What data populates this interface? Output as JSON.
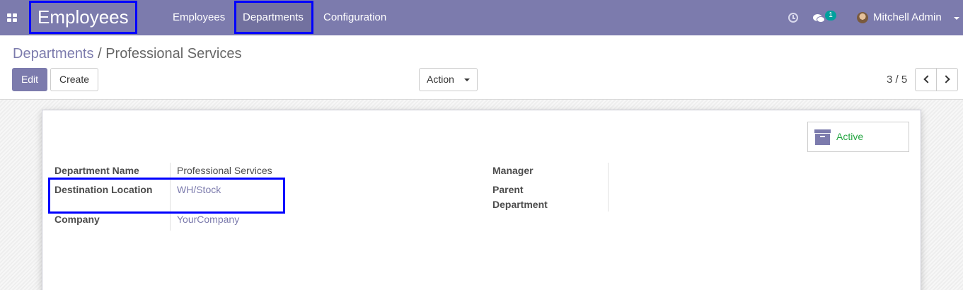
{
  "navbar": {
    "app_title": "Employees",
    "menu": [
      "Employees",
      "Departments",
      "Configuration"
    ],
    "chat_count": "1",
    "user_name": "Mitchell Admin"
  },
  "breadcrumb": {
    "parent": "Departments",
    "separator": "/",
    "current": "Professional Services"
  },
  "buttons": {
    "edit": "Edit",
    "create": "Create",
    "action": "Action"
  },
  "pager": {
    "value": "3 / 5"
  },
  "sheet": {
    "status_button": "Active",
    "fields_left": [
      {
        "label": "Department Name",
        "value": "Professional Services"
      },
      {
        "label": "Destination Location",
        "value": "WH/Stock"
      },
      {
        "label": "Company",
        "value": "YourCompany"
      }
    ],
    "fields_right": [
      {
        "label": "Manager",
        "value": ""
      },
      {
        "label": "Parent Department",
        "value": ""
      }
    ]
  },
  "colors": {
    "brand": "#7c7bad",
    "highlight": "#0000ff",
    "active_green": "#28a745"
  }
}
